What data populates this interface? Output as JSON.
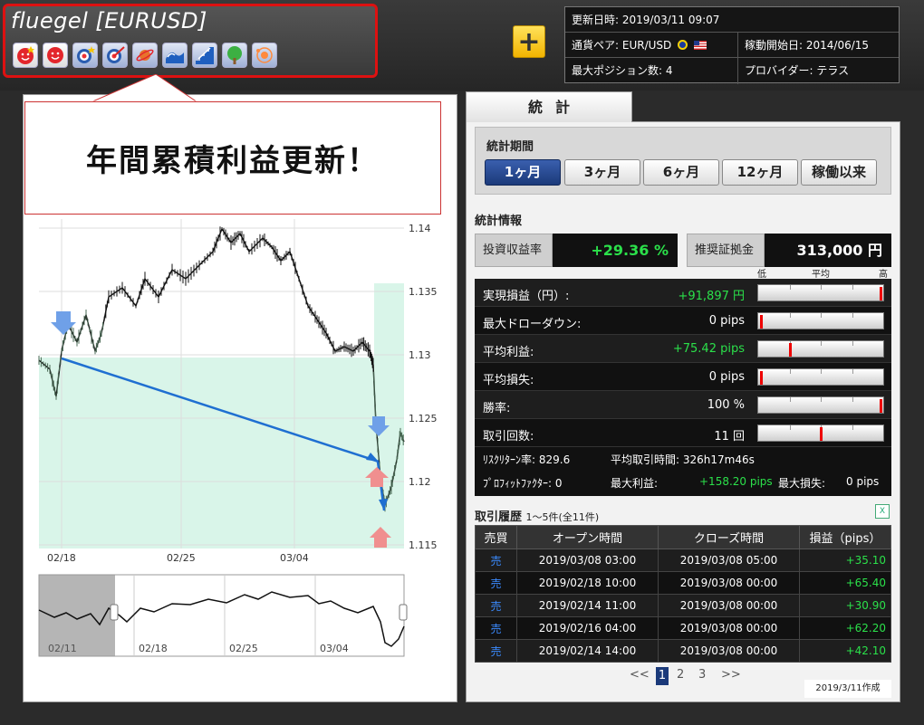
{
  "header": {
    "ea_title": "fluegel [EURUSD]",
    "badges": [
      "smile-star-icon",
      "smile-icon",
      "target-star-icon",
      "target-arrow-icon",
      "planet-icon",
      "wave-icon",
      "stairs-icon",
      "tree-icon",
      "orbit-icon"
    ],
    "info": {
      "updated_label": "更新日時:",
      "updated_value": "2019/03/11 09:07",
      "pair_label": "通貨ペア:",
      "pair_value": "EUR/USD",
      "start_label": "稼動開始日:",
      "start_value": "2014/06/15",
      "maxpos_label": "最大ポジション数:",
      "maxpos_value": "4",
      "provider_label": "プロバイダー:",
      "provider_value": "テラス"
    }
  },
  "callout": {
    "text": "年間累積利益更新！"
  },
  "chart": {
    "y_ticks": [
      "1.14",
      "1.135",
      "1.13",
      "1.125",
      "1.12",
      "1.115"
    ],
    "x_ticks": [
      "02/18",
      "02/25",
      "03/04"
    ],
    "nav_ticks": [
      "02/11",
      "02/18",
      "02/25",
      "03/04"
    ]
  },
  "stats_panel": {
    "tab_label": "統計",
    "period_label": "統計期間",
    "periods": [
      {
        "label": "1ヶ月",
        "active": true
      },
      {
        "label": "3ヶ月",
        "active": false
      },
      {
        "label": "6ヶ月",
        "active": false
      },
      {
        "label": "12ヶ月",
        "active": false
      },
      {
        "label": "稼働以来",
        "active": false
      }
    ],
    "info_title": "統計情報",
    "roi_label": "投資収益率",
    "roi_value": "+29.36 %",
    "margin_label": "推奨証拠金",
    "margin_value": "313,000 円",
    "scale": {
      "low": "低",
      "avg": "平均",
      "high": "高"
    },
    "rows": [
      {
        "label": "実現損益（円）:",
        "value": "+91,897 円",
        "green": true,
        "level": 0.98
      },
      {
        "label": "最大ドローダウン:",
        "value": "0 pips",
        "green": false,
        "level": 0.02
      },
      {
        "label": "平均利益:",
        "value": "+75.42 pips",
        "green": true,
        "level": 0.25
      },
      {
        "label": "平均損失:",
        "value": "0 pips",
        "green": false,
        "level": 0.02
      },
      {
        "label": "勝率:",
        "value": "100 %",
        "green": false,
        "level": 0.98
      },
      {
        "label": "取引回数:",
        "value": "11 回",
        "green": false,
        "level": 0.5
      }
    ],
    "extra": {
      "rr_label": "ﾘｽｸﾘﾀｰﾝ率: 829.6",
      "avg_time_label": "平均取引時間: 326h17m46s",
      "pf_label": "ﾌﾟﾛﾌｨｯﾄﾌｧｸﾀｰ: 0",
      "max_profit_label": "最大利益:",
      "max_profit_value": "+158.20 pips",
      "max_loss_label": "最大損失:",
      "max_loss_value": "0 pips"
    }
  },
  "history": {
    "title": "取引履歴",
    "subtitle": "1〜5件(全11件)",
    "headers": [
      "売買",
      "オープン時間",
      "クローズ時間",
      "損益（pips）"
    ],
    "rows": [
      {
        "side": "売",
        "open": "2019/03/08 03:00",
        "close": "2019/03/08 05:00",
        "pips": "+35.10"
      },
      {
        "side": "売",
        "open": "2019/02/18 10:00",
        "close": "2019/03/08 00:00",
        "pips": "+65.40"
      },
      {
        "side": "売",
        "open": "2019/02/14 11:00",
        "close": "2019/03/08 00:00",
        "pips": "+30.90"
      },
      {
        "side": "売",
        "open": "2019/02/16 04:00",
        "close": "2019/03/08 00:00",
        "pips": "+62.20"
      },
      {
        "side": "売",
        "open": "2019/02/14 14:00",
        "close": "2019/03/08 00:00",
        "pips": "+42.10"
      }
    ],
    "pager": {
      "prev": "<<",
      "pages": [
        "1",
        "2",
        "3"
      ],
      "next": ">>"
    }
  },
  "footer": {
    "created": "2019/3/11作成"
  }
}
